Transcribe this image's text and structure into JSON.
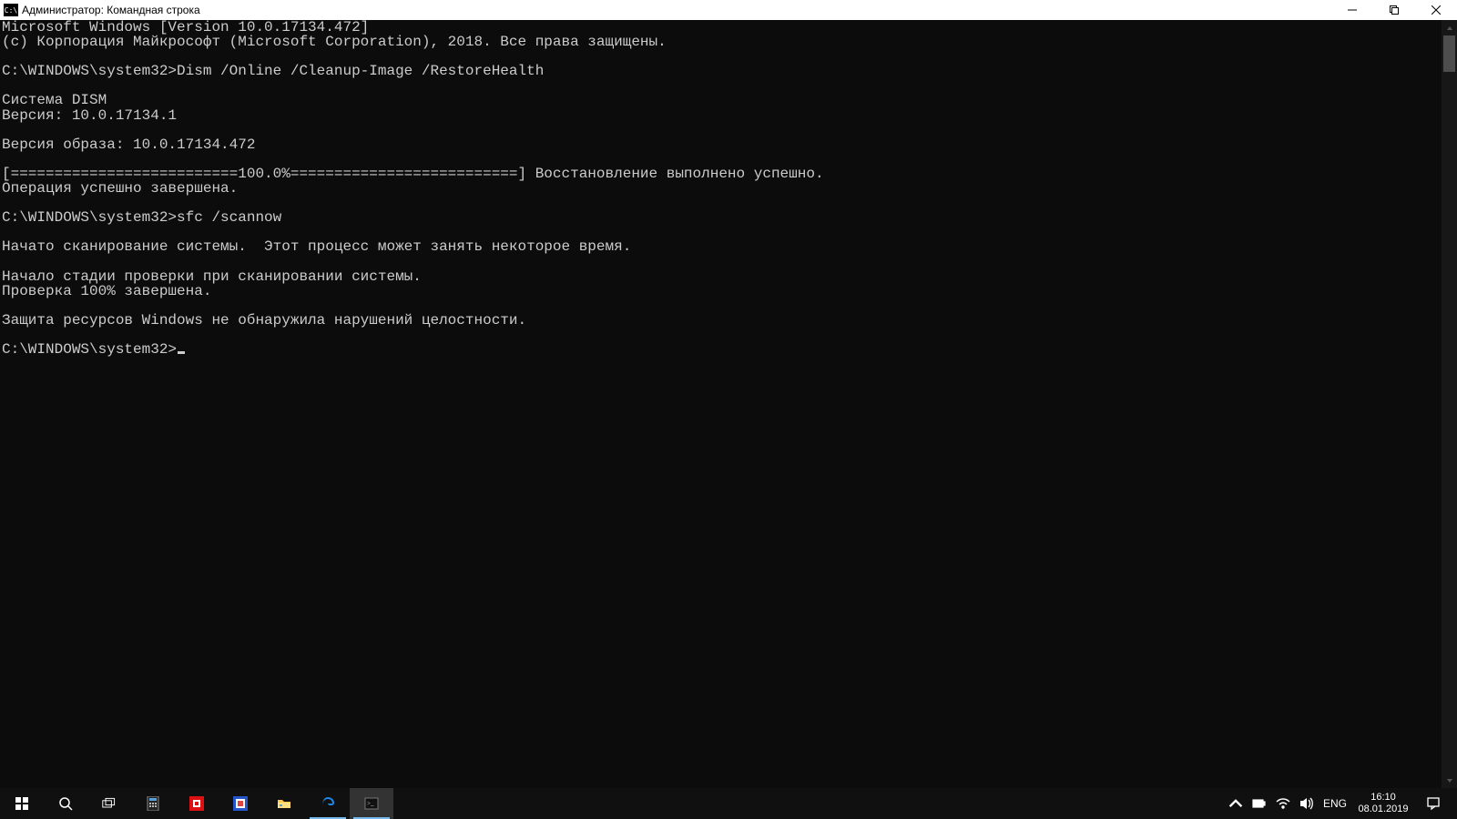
{
  "titlebar": {
    "icon_text": "C:\\",
    "title": "Администратор: Командная строка"
  },
  "console": {
    "lines": [
      "Microsoft Windows [Version 10.0.17134.472]",
      "(c) Корпорация Майкрософт (Microsoft Corporation), 2018. Все права защищены.",
      "",
      "C:\\WINDOWS\\system32>Dism /Online /Cleanup-Image /RestoreHealth",
      "",
      "Cистема DISM",
      "Версия: 10.0.17134.1",
      "",
      "Версия образа: 10.0.17134.472",
      "",
      "[==========================100.0%==========================] Восстановление выполнено успешно.",
      "Операция успешно завершена.",
      "",
      "C:\\WINDOWS\\system32>sfc /scannow",
      "",
      "Начато сканирование системы.  Этот процесс может занять некоторое время.",
      "",
      "Начало стадии проверки при сканировании системы.",
      "Проверка 100% завершена.",
      "",
      "Защита ресурсов Windows не обнаружила нарушений целостности.",
      ""
    ],
    "final_prompt": "C:\\WINDOWS\\system32>"
  },
  "tray": {
    "language": "ENG",
    "time": "16:10",
    "date": "08.01.2019"
  }
}
